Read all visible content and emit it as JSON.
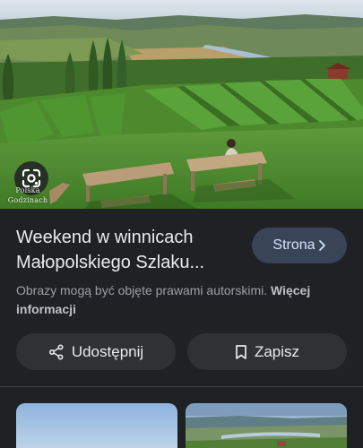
{
  "image": {
    "watermark_line1": "Polska",
    "watermark_line2": "Godzinach"
  },
  "result": {
    "title": "Weekend w winnicach Małopolskiego Szlaku...",
    "visit_label": "Strona",
    "copyright_note": "Obrazy mogą być objęte prawami autorskimi.",
    "more_info_label": "Więcej informacji"
  },
  "actions": {
    "share_label": "Udostępnij",
    "save_label": "Zapisz"
  },
  "icons": {
    "lens": "google-lens-icon",
    "visit": "chevron-right-icon",
    "share": "share-icon",
    "save": "bookmark-icon"
  },
  "colors": {
    "background": "#202124",
    "button_bg": "#303134",
    "visit_button_bg": "#394457",
    "visit_button_text": "#d2e3fc"
  }
}
